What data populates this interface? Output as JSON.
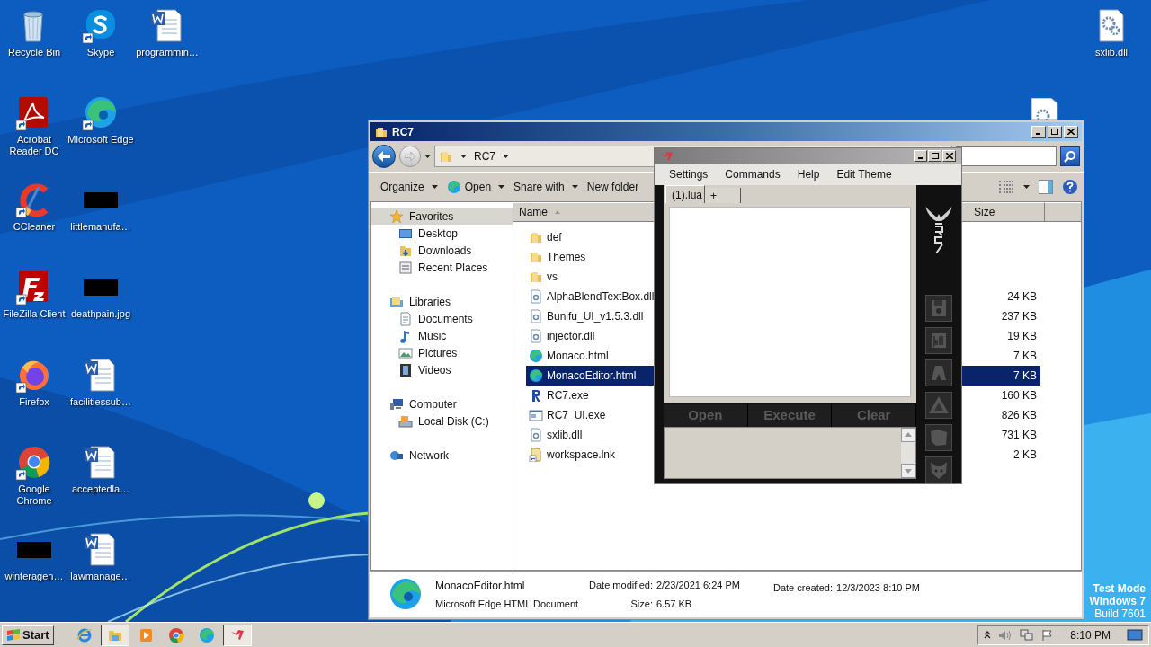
{
  "desktop_icons": [
    {
      "label": "Recycle Bin",
      "kind": "recycle",
      "shortcut": false
    },
    {
      "label": "Acrobat Reader DC",
      "kind": "acrobat",
      "shortcut": true
    },
    {
      "label": "CCleaner",
      "kind": "ccleaner",
      "shortcut": true
    },
    {
      "label": "FileZilla Client",
      "kind": "filezilla",
      "shortcut": true
    },
    {
      "label": "Firefox",
      "kind": "firefox",
      "shortcut": true
    },
    {
      "label": "Google Chrome",
      "kind": "chrome",
      "shortcut": true
    },
    {
      "label": "winteragen…",
      "kind": "blackimg",
      "shortcut": false
    },
    {
      "label": "Skype",
      "kind": "skype",
      "shortcut": true
    },
    {
      "label": "Microsoft Edge",
      "kind": "edge",
      "shortcut": true
    },
    {
      "label": "littlemanufa…",
      "kind": "blackimg",
      "shortcut": false
    },
    {
      "label": "deathpain.jpg",
      "kind": "blackimg",
      "shortcut": false
    },
    {
      "label": "facilitiessub…",
      "kind": "word",
      "shortcut": false
    },
    {
      "label": "acceptedla…",
      "kind": "word",
      "shortcut": false
    },
    {
      "label": "lawmanage…",
      "kind": "word",
      "shortcut": false
    },
    {
      "label": "programmin…",
      "kind": "word",
      "shortcut": false
    }
  ],
  "right_icons": [
    {
      "label": "sxlib.dll",
      "kind": "dll",
      "shortcut": false
    }
  ],
  "explorer": {
    "title": "RC7",
    "breadcrumb": "RC7",
    "toolbar": [
      {
        "label": "Organize",
        "kind": "plain",
        "dropdown": true
      },
      {
        "label": "Open",
        "kind": "edge",
        "dropdown": true
      },
      {
        "label": "Share with",
        "kind": "plain",
        "dropdown": true
      },
      {
        "label": "New folder",
        "kind": "plain",
        "dropdown": false
      }
    ],
    "nav": [
      {
        "label": "Favorites",
        "kind": "star",
        "selected": true,
        "children": [
          {
            "label": "Desktop",
            "kind": "desktop",
            "selected": false
          },
          {
            "label": "Downloads",
            "kind": "downloads",
            "selected": false
          },
          {
            "label": "Recent Places",
            "kind": "recent",
            "selected": false
          }
        ]
      },
      {
        "label": "Libraries",
        "kind": "libraries",
        "selected": false,
        "children": [
          {
            "label": "Documents",
            "kind": "documents",
            "selected": false
          },
          {
            "label": "Music",
            "kind": "music",
            "selected": false
          },
          {
            "label": "Pictures",
            "kind": "pictures",
            "selected": false
          },
          {
            "label": "Videos",
            "kind": "videos",
            "selected": false
          }
        ]
      },
      {
        "label": "Computer",
        "kind": "computer",
        "selected": false,
        "children": [
          {
            "label": "Local Disk (C:)",
            "kind": "disk",
            "selected": false
          }
        ]
      },
      {
        "label": "Network",
        "kind": "network",
        "selected": false
      }
    ],
    "columns": [
      {
        "label": "Name",
        "sorted": true
      },
      {
        "label": "Size",
        "sorted": false
      }
    ],
    "files": [
      {
        "name": "def",
        "kind": "folder",
        "selected": false
      },
      {
        "name": "Themes",
        "kind": "folder",
        "selected": false
      },
      {
        "name": "vs",
        "kind": "folder",
        "selected": false
      },
      {
        "name": "AlphaBlendTextBox.dll",
        "kind": "dll",
        "size": "24 KB",
        "selected": false
      },
      {
        "name": "Bunifu_UI_v1.5.3.dll",
        "kind": "dll",
        "size": "237 KB",
        "selected": false
      },
      {
        "name": "injector.dll",
        "kind": "dll",
        "size": "19 KB",
        "selected": false
      },
      {
        "name": "Monaco.html",
        "kind": "edge",
        "size": "7 KB",
        "selected": false
      },
      {
        "name": "MonacoEditor.html",
        "kind": "edge",
        "size": "7 KB",
        "selected": true
      },
      {
        "name": "RC7.exe",
        "kind": "r",
        "size": "160 KB",
        "selected": false
      },
      {
        "name": "RC7_UI.exe",
        "kind": "exe",
        "size": "826 KB",
        "selected": false
      },
      {
        "name": "sxlib.dll",
        "kind": "dll",
        "size": "731 KB",
        "selected": false
      },
      {
        "name": "workspace.lnk",
        "kind": "lnk",
        "size": "2 KB",
        "selected": false
      }
    ],
    "details": {
      "name": "MonacoEditor.html",
      "type": "Microsoft Edge HTML Document",
      "fields": [
        {
          "label": "Date modified:",
          "value": "2/23/2021 6:24 PM"
        },
        {
          "label": "Size:",
          "value": "6.57 KB"
        },
        {
          "label": "Date created:",
          "value": "12/3/2023 8:10 PM"
        }
      ]
    }
  },
  "rc7": {
    "menu": [
      "Settings",
      "Commands",
      "Help",
      "Edit Theme"
    ],
    "tabs": [
      {
        "label": "(1).lua",
        "selected": true
      },
      {
        "label": "+",
        "selected": false
      }
    ],
    "actions": [
      "Open",
      "Execute",
      "Clear"
    ],
    "tools": [
      {
        "kind": "disk"
      },
      {
        "kind": "scroll"
      },
      {
        "kind": "figure"
      },
      {
        "kind": "triangle"
      },
      {
        "kind": "map"
      },
      {
        "kind": "wolf"
      }
    ]
  },
  "taskbar": {
    "start": "Start",
    "apps": [
      {
        "kind": "ie",
        "active": false
      },
      {
        "kind": "explorer",
        "active": true
      },
      {
        "kind": "media",
        "active": false
      },
      {
        "kind": "chrome",
        "active": false
      },
      {
        "kind": "edge",
        "active": false
      },
      {
        "kind": "rc7",
        "active": true
      }
    ],
    "time": "8:10 PM"
  },
  "test_mode": [
    "Test Mode",
    "Windows 7",
    "Build 7601"
  ]
}
